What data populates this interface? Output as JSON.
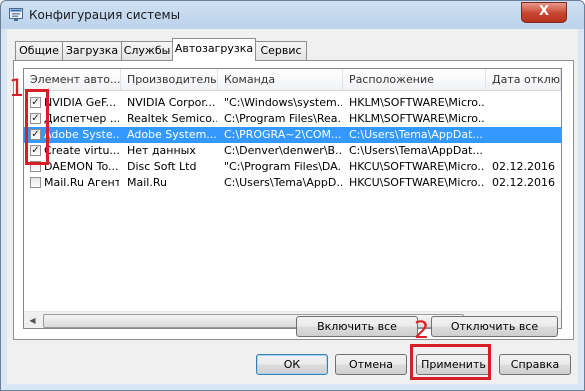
{
  "window": {
    "title": "Конфигурация системы",
    "close_glyph": "X"
  },
  "tabs": [
    {
      "label": "Общие"
    },
    {
      "label": "Загрузка"
    },
    {
      "label": "Службы"
    },
    {
      "label": "Автозагрузка"
    },
    {
      "label": "Сервис"
    }
  ],
  "active_tab": "Автозагрузка",
  "columns": [
    {
      "label": "Элемент авто..."
    },
    {
      "label": "Производитель"
    },
    {
      "label": "Команда"
    },
    {
      "label": "Расположение"
    },
    {
      "label": "Дата отклю"
    }
  ],
  "rows": [
    {
      "checked": true,
      "check_glyph": "✓",
      "item": "NVIDIA GeF...",
      "maker": "NVIDIA Corpor...",
      "command": "\"C:\\Windows\\system...",
      "location": "HKLM\\SOFTWARE\\Micro...",
      "date": ""
    },
    {
      "checked": true,
      "check_glyph": "✓",
      "item": "Диспетчер ...",
      "maker": "Realtek Semico...",
      "command": "C:\\Program Files\\Rea...",
      "location": "HKLM\\SOFTWARE\\Micro...",
      "date": ""
    },
    {
      "checked": true,
      "check_glyph": "✓",
      "item": "Adobe Syste...",
      "maker": "Adobe System...",
      "command": "C:\\PROGRA~2\\COM...",
      "location": "C:\\Users\\Tema\\AppDat...",
      "date": "",
      "selected": true
    },
    {
      "checked": true,
      "check_glyph": "✓",
      "item": "Create virtu...",
      "maker": "Нет данных",
      "command": "C:\\Denver\\denwer\\B...",
      "location": "C:\\Users\\Tema\\AppDat...",
      "date": ""
    },
    {
      "checked": false,
      "check_glyph": "",
      "item": "DAEMON To...",
      "maker": "Disc Soft Ltd",
      "command": "\"C:\\Program Files\\DA...",
      "location": "HKCU\\SOFTWARE\\Micro...",
      "date": "02.12.2016"
    },
    {
      "checked": false,
      "check_glyph": "",
      "item": "Mail.Ru Агент",
      "maker": "Mail.Ru",
      "command": "C:\\Users\\Tema\\AppD...",
      "location": "HKCU\\SOFTWARE\\Micro...",
      "date": "02.12.2016"
    }
  ],
  "scrollbar": {
    "left_glyph": "◀",
    "right_glyph": "▶"
  },
  "buttons": {
    "enable_all": "Включить все",
    "disable_all": "Отключить все",
    "ok": "ОК",
    "cancel": "Отмена",
    "apply": "Применить",
    "help": "Справка"
  },
  "annotations": {
    "marker_1": "1",
    "marker_2": "2",
    "color": "#d81f26"
  },
  "colors": {
    "selection": "#3399ff",
    "titlebar": "#bcd3ec",
    "close_button": "#c7452f"
  },
  "icons": [
    "app-icon",
    "close-icon",
    "checkbox-icon",
    "scroll-left-icon",
    "scroll-right-icon"
  ]
}
